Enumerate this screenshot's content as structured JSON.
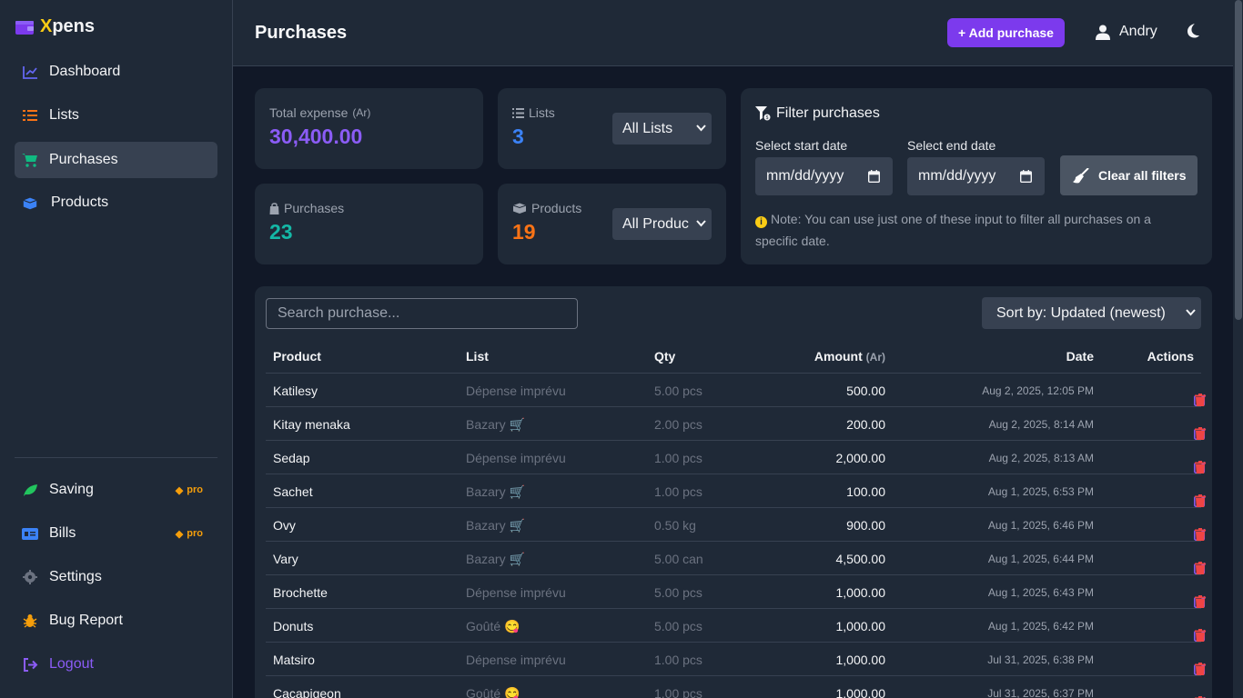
{
  "app": {
    "logo_first": "X",
    "logo_rest": "pens"
  },
  "sidebar": {
    "items": [
      {
        "label": "Dashboard",
        "icon": "chart-line-icon"
      },
      {
        "label": "Lists",
        "icon": "list-icon"
      },
      {
        "label": "Purchases",
        "icon": "cart-icon",
        "active": true
      },
      {
        "label": "Products",
        "icon": "boxes-icon"
      }
    ],
    "bottom": [
      {
        "label": "Saving",
        "icon": "leaf-icon",
        "badge": "pro"
      },
      {
        "label": "Bills",
        "icon": "bill-icon",
        "badge": "pro"
      },
      {
        "label": "Settings",
        "icon": "gear-icon"
      },
      {
        "label": "Bug Report",
        "icon": "bug-icon"
      },
      {
        "label": "Logout",
        "icon": "logout-icon"
      }
    ]
  },
  "header": {
    "title": "Purchases",
    "add_label": "+ Add purchase",
    "user": "Andry"
  },
  "stats": {
    "total_label": "Total expense",
    "total_unit": "(Ar)",
    "total_value": "30,400.00",
    "lists_label": "Lists",
    "lists_value": "3",
    "lists_select": "All Lists",
    "purchases_label": "Purchases",
    "purchases_value": "23",
    "products_label": "Products",
    "products_value": "19",
    "products_select": "All Produc"
  },
  "filter": {
    "title": "Filter purchases",
    "start_label": "Select start date",
    "start_placeholder": "mm/dd/yyyy",
    "end_label": "Select end date",
    "end_placeholder": "mm/dd/yyyy",
    "clear_label": "Clear all filters",
    "note": "Note: You can use just one of these input to filter all purchases on a specific date."
  },
  "table": {
    "search_placeholder": "Search purchase...",
    "sort_label": "Sort by: Updated (newest)",
    "headers": {
      "product": "Product",
      "list": "List",
      "qty": "Qty",
      "amount": "Amount",
      "amount_unit": "(Ar)",
      "date": "Date",
      "actions": "Actions"
    },
    "rows": [
      {
        "product": "Katilesy",
        "list": "Dépense imprévu",
        "qty": "5.00 pcs",
        "amount": "500.00",
        "date": "Aug 2, 2025, 12:05 PM"
      },
      {
        "product": "Kitay menaka",
        "list": "Bazary 🛒",
        "qty": "2.00 pcs",
        "amount": "200.00",
        "date": "Aug 2, 2025, 8:14 AM"
      },
      {
        "product": "Sedap",
        "list": "Dépense imprévu",
        "qty": "1.00 pcs",
        "amount": "2,000.00",
        "date": "Aug 2, 2025, 8:13 AM"
      },
      {
        "product": "Sachet",
        "list": "Bazary 🛒",
        "qty": "1.00 pcs",
        "amount": "100.00",
        "date": "Aug 1, 2025, 6:53 PM"
      },
      {
        "product": "Ovy",
        "list": "Bazary 🛒",
        "qty": "0.50 kg",
        "amount": "900.00",
        "date": "Aug 1, 2025, 6:46 PM"
      },
      {
        "product": "Vary",
        "list": "Bazary 🛒",
        "qty": "5.00 can",
        "amount": "4,500.00",
        "date": "Aug 1, 2025, 6:44 PM"
      },
      {
        "product": "Brochette",
        "list": "Dépense imprévu",
        "qty": "5.00 pcs",
        "amount": "1,000.00",
        "date": "Aug 1, 2025, 6:43 PM"
      },
      {
        "product": "Donuts",
        "list": "Goûté 😋",
        "qty": "5.00 pcs",
        "amount": "1,000.00",
        "date": "Aug 1, 2025, 6:42 PM"
      },
      {
        "product": "Matsiro",
        "list": "Dépense imprévu",
        "qty": "1.00 pcs",
        "amount": "1,000.00",
        "date": "Jul 31, 2025, 6:38 PM"
      },
      {
        "product": "Cacapigeon",
        "list": "Goûté 😋",
        "qty": "1.00 pcs",
        "amount": "1,000.00",
        "date": "Jul 31, 2025, 6:37 PM"
      }
    ]
  },
  "colors": {
    "accent": "#7c3aed",
    "total": "#8b5cf6",
    "lists": "#3b82f6",
    "purchases": "#14b8a6",
    "products": "#f97316",
    "danger": "#ef4444",
    "pro": "#f59e0b"
  }
}
